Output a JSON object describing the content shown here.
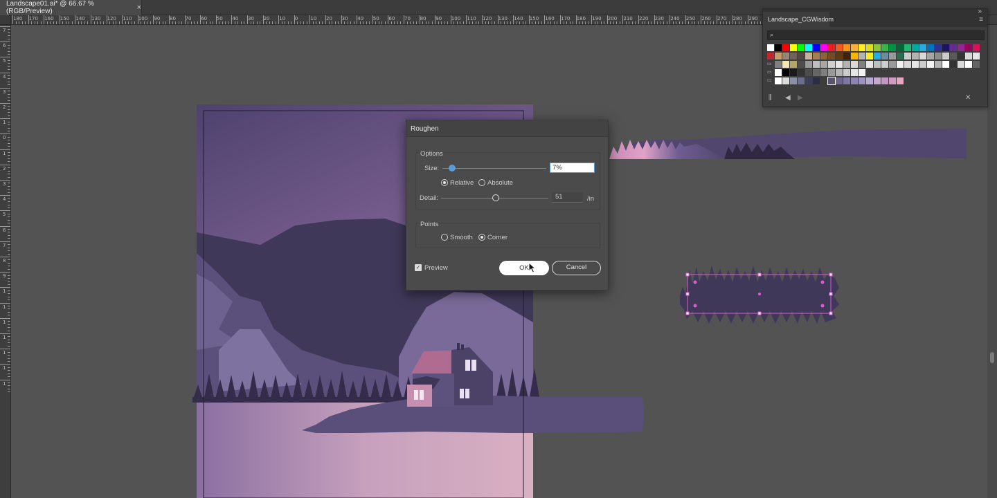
{
  "document_tab": {
    "title": "Landscape01.ai* @ 66.67 % (RGB/Preview)",
    "close": "×"
  },
  "ruler": {
    "top_labels": [
      "180",
      "170",
      "160",
      "150",
      "140",
      "130",
      "120",
      "110",
      "100",
      "90",
      "80",
      "70",
      "60",
      "50",
      "40",
      "30",
      "20",
      "10",
      "0",
      "10",
      "20",
      "30",
      "40",
      "50",
      "60",
      "70",
      "80",
      "90",
      "100",
      "110",
      "120",
      "130",
      "140",
      "150",
      "160",
      "170",
      "180",
      "190",
      "200",
      "210",
      "220",
      "230",
      "240",
      "250",
      "260",
      "270",
      "280",
      "290",
      "300",
      "310"
    ],
    "left_labels": [
      "7",
      "6",
      "5",
      "4",
      "3",
      "2",
      "1",
      "0",
      "1",
      "2",
      "3",
      "4",
      "5",
      "6",
      "7",
      "8",
      "9",
      "1",
      "1",
      "1",
      "1",
      "1",
      "1",
      "1"
    ]
  },
  "swatches_panel": {
    "tab_label": "Landscape_CGWisdom",
    "close": "»",
    "menu": "≡",
    "search_icon": "search-icon",
    "rows": [
      [
        "#ffffff",
        "#000000",
        "#ff0000",
        "#ffff00",
        "#00ff00",
        "#00ffff",
        "#0000ff",
        "#ff00ff",
        "#ed1c24",
        "#f15a24",
        "#f7931e",
        "#fbb03b",
        "#fcee21",
        "#d9e021",
        "#8cc63f",
        "#39b54a",
        "#009245",
        "#006837",
        "#22b573",
        "#00a99d",
        "#29abe2",
        "#0071bc",
        "#2e3192",
        "#1b1464",
        "#662d91",
        "#93278f",
        "#9e005d",
        "#d4145a"
      ],
      [
        "#c1272d",
        "#c69c6d",
        "#998675",
        "#736357",
        "#534741",
        "#c7b299",
        "#a67c52",
        "#8c6239",
        "#754c24",
        "#603813",
        "#42210b",
        "#f7b500",
        "#b3b3b3",
        "#fcee21",
        "#29abe2",
        "#6b8e9e",
        "#999999",
        "#2e6b4e",
        "#cccccc",
        "#b3b3b3",
        "#d9d9d9",
        "#a6a6a6",
        "#8c8c8c",
        "#cccccc",
        "#595959",
        "#333333",
        "#d9d9d9",
        "#e6e6e6"
      ],
      [
        "#808080",
        "#f2e6b3",
        "#b3a66b",
        "#4d4d4d",
        "#999999",
        "#bfbfbf",
        "#a6a6a6",
        "#cfcfcf",
        "#e6e6e6",
        "#b3b3b3",
        "#d9d9d9",
        "#808080",
        "#e6e6e6",
        "#bfbfbf",
        "#cccccc",
        "#999999",
        "#f2f2f2",
        "#d9d9d9",
        "#e6e6e6",
        "#cccccc",
        "#f2f2f2",
        "#b3b3b3",
        "#ffffff",
        "#333333",
        "#d9d9d9",
        "#ffffff",
        "#666666"
      ],
      [
        "#ffffff",
        "#000000",
        "#1a1a1a",
        "#333333",
        "#4d4d4d",
        "#666666",
        "#808080",
        "#999999",
        "#b3b3b3",
        "#cccccc",
        "#e6e6e6",
        "#f2f2f2"
      ],
      [
        "#ffffff",
        "#dcdcdc",
        "#8a8ea6",
        "#6b6f8c",
        "#3c3f5a",
        "#2b2d44",
        "#3d3d3d",
        "#5a5470",
        "#6e6690",
        "#7e76a3",
        "#8d84b3",
        "#9d93c0",
        "#b7a9d6",
        "#c6a8cf",
        "#c497c2",
        "#d39abf",
        "#e7a7c0"
      ]
    ],
    "row_folder_icons": [
      "",
      "",
      "folder-icon",
      "folder-icon",
      "folder-icon"
    ],
    "footer": {
      "library_icon": "library-icon",
      "prev_icon": "chevron-left-icon",
      "next_icon": "chevron-right-icon",
      "tools_icon": "wrench-icon"
    }
  },
  "roughen_dialog": {
    "title": "Roughen",
    "options_group": "Options",
    "size_label": "Size:",
    "size_value": "7%",
    "size_fraction": 0.09,
    "relative_label": "Relative",
    "absolute_label": "Absolute",
    "relative_selected": true,
    "detail_label": "Detail:",
    "detail_value": "51",
    "detail_unit": "/in",
    "detail_fraction": 0.51,
    "points_group": "Points",
    "smooth_label": "Smooth",
    "corner_label": "Corner",
    "corner_selected": true,
    "preview_label": "Preview",
    "preview_checked": true,
    "ok_label": "OK",
    "cancel_label": "Cancel"
  },
  "colors": {
    "sky_top": "#5a4a7a",
    "sky_bottom": "#a07aa6",
    "mountain_dark": "#3e3656",
    "mountain_mid": "#5a4e7a",
    "lake": "#c9a3bd",
    "house_roof": "#b06c90",
    "selection": "#e05ad6"
  }
}
